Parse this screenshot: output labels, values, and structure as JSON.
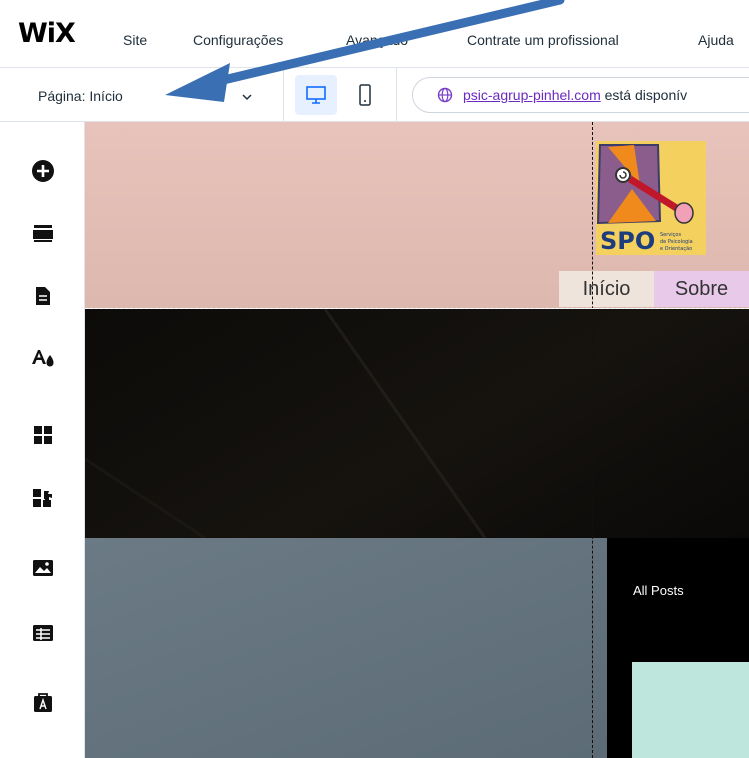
{
  "topbar": {
    "logo": "WiX",
    "menu": [
      "Site",
      "Configurações",
      "Avançado",
      "Contrate um profissional",
      "Ajuda"
    ]
  },
  "toolbar": {
    "page_label": "Página: Início",
    "url_domain": "psic-agrup-pinhel.com",
    "url_suffix": " está disponív"
  },
  "left_tools": [
    "add-icon",
    "sections-icon",
    "pages-icon",
    "theme-icon",
    "apps-icon",
    "add-apps-icon",
    "media-icon",
    "cms-icon",
    "portfolio-icon"
  ],
  "canvas": {
    "logo_text": "SPO",
    "logo_sub": "Serviços de Psicologia e Orientação",
    "nav": [
      "Início",
      "Sobre"
    ],
    "all_posts": "All Posts"
  },
  "colors": {
    "accent": "#116dff",
    "arrow": "#3a6fb3",
    "header_bg": "#e2beb5",
    "nav_active": "#efe4dc",
    "nav_sobre": "#e8c9e9"
  }
}
